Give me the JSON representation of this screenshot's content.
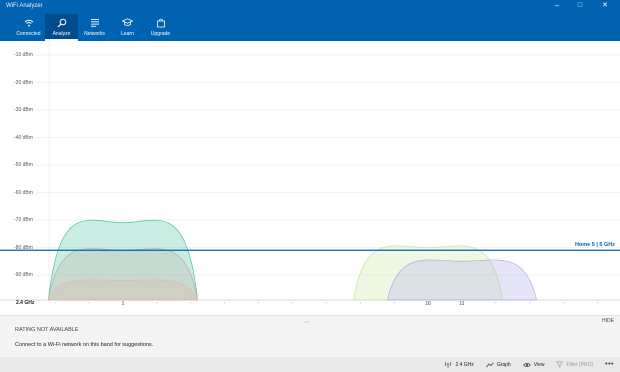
{
  "window": {
    "title": "WiFi Analyzer",
    "controls": {
      "minimize": "–",
      "maximize": "□",
      "close": "✕"
    }
  },
  "nav": {
    "items": [
      {
        "label": "Connected",
        "icon": "wifi-icon",
        "active": false
      },
      {
        "label": "Analyze",
        "icon": "magnifier-icon",
        "active": true
      },
      {
        "label": "Networks",
        "icon": "list-icon",
        "active": false
      },
      {
        "label": "Learn",
        "icon": "graduation-cap-icon",
        "active": false
      },
      {
        "label": "Upgrade",
        "icon": "store-bag-icon",
        "active": false
      }
    ]
  },
  "chart_data": {
    "type": "area",
    "band": "2.4 GHz",
    "ylabel_unit": "dBm",
    "y_ticks": [
      "-10 dBm",
      "-20 dBm",
      "-30 dBm",
      "-40 dBm",
      "-50 dBm",
      "-60 dBm",
      "-70 dBm",
      "-80 dBm",
      "-90 dBm"
    ],
    "ylim": [
      -100,
      -10
    ],
    "x_ticks": [
      "1",
      "10",
      "11"
    ],
    "xlim": [
      -1,
      15
    ],
    "grid": true,
    "series": [
      {
        "channel": 1,
        "signal": -71,
        "color": "#3dbf9a"
      },
      {
        "channel": 1,
        "signal": -81,
        "color": "#b9a9a0"
      },
      {
        "channel": 1,
        "signal": -92,
        "color": "#e8b8a0"
      },
      {
        "channel": 10,
        "signal": -80,
        "color": "#c5e59a"
      },
      {
        "channel": 11,
        "signal": -85,
        "color": "#a9a7e6"
      }
    ],
    "connected_network": {
      "name": "Home 5 | 5 GHz",
      "signal": -81,
      "color": "#0063b1"
    }
  },
  "panel": {
    "hide_label": "HIDE",
    "rating": "RATING NOT AVAILABLE",
    "suggestion": "Connect to a Wi-Fi network on this band for suggestions."
  },
  "commandbar": {
    "band": "2.4 GHz",
    "graph": "Graph",
    "view": "View",
    "filter": "Filter (PRO)"
  }
}
